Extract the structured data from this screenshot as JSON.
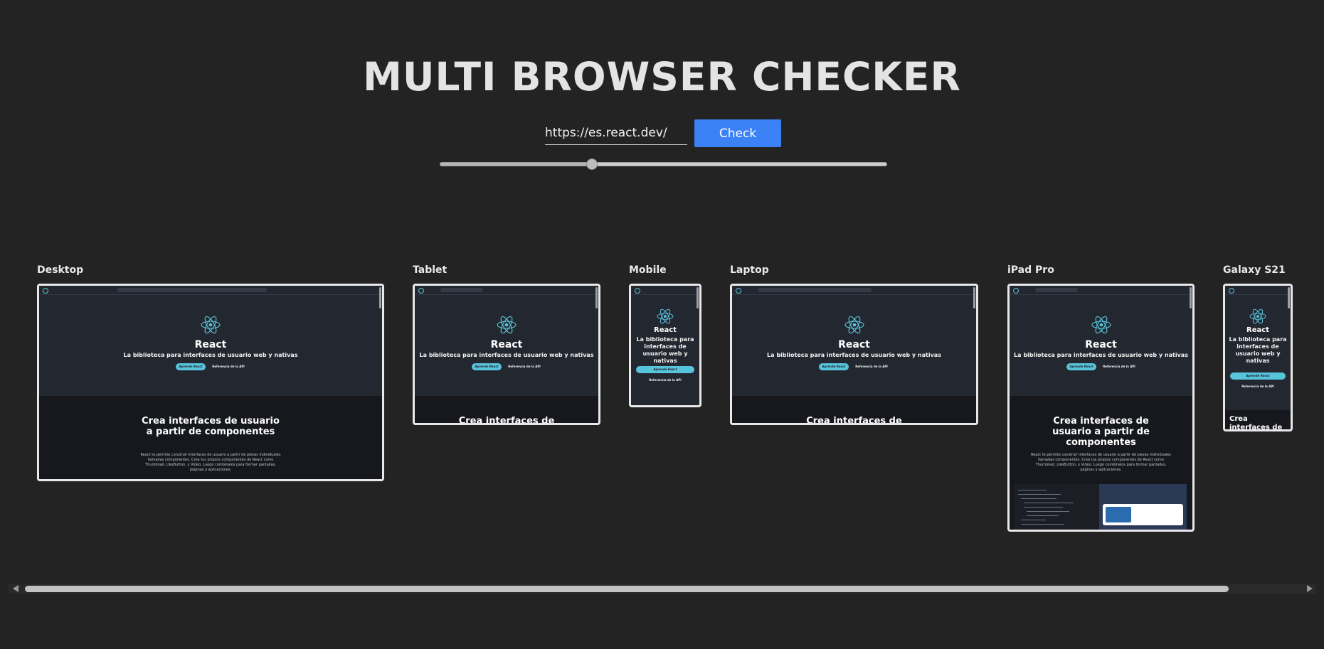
{
  "title": "MULTI BROWSER CHECKER",
  "url_input": {
    "value": "https://es.react.dev/"
  },
  "check_button": {
    "label": "Check"
  },
  "slider": {
    "value_fraction": 0.34
  },
  "devices": [
    {
      "name": "Desktop"
    },
    {
      "name": "Tablet"
    },
    {
      "name": "Mobile"
    },
    {
      "name": "Laptop"
    },
    {
      "name": "iPad Pro"
    },
    {
      "name": "Galaxy S21"
    }
  ],
  "preview": {
    "hero_title": "React",
    "hero_subtitle": "La biblioteca para interfaces de usuario web y nativas",
    "primary_button": "Aprende React",
    "secondary_button": "Referencia de la API",
    "section_title": "Crea interfaces de usuario a partir de componentes",
    "section_text": "React te permite construir interfaces de usuario a partir de piezas individuales llamadas componentes. Crea tus propios componentes de React como Thumbnail, LikeButton, y Video. Luego combínalos para formar pantallas, páginas y aplicaciones."
  },
  "colors": {
    "background": "#232323",
    "accent_button": "#3b82f6",
    "react_cyan": "#58c4dc",
    "preview_bg": "#23272f"
  }
}
